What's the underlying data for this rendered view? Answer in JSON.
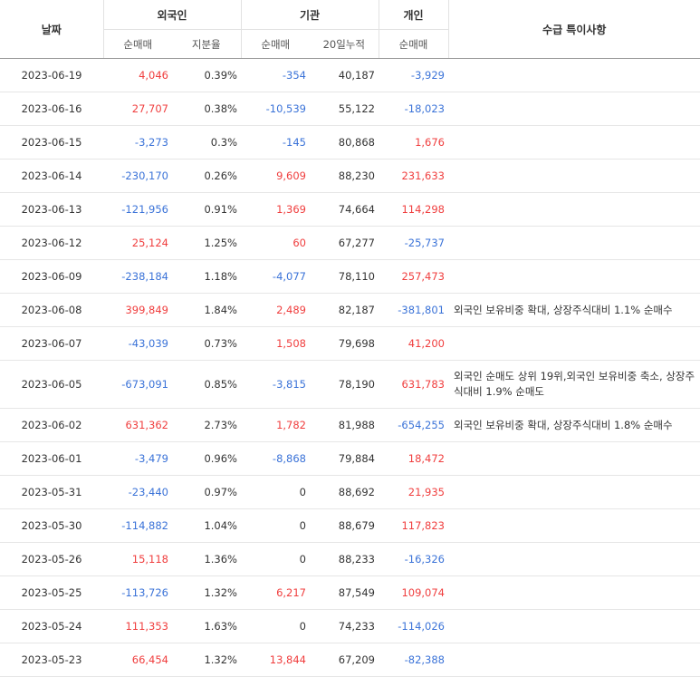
{
  "header": {
    "date": "날짜",
    "foreign": "외국인",
    "institution": "기관",
    "individual": "개인",
    "note": "수급 특이사항",
    "net": "순매매",
    "share": "지분율",
    "acc20": "20일누적"
  },
  "rows": [
    {
      "date": "2023-06-19",
      "f_net": "4,046",
      "f_share": "0.39%",
      "i_net": "-354",
      "i_20": "40,187",
      "p_net": "-3,929",
      "note": ""
    },
    {
      "date": "2023-06-16",
      "f_net": "27,707",
      "f_share": "0.38%",
      "i_net": "-10,539",
      "i_20": "55,122",
      "p_net": "-18,023",
      "note": ""
    },
    {
      "date": "2023-06-15",
      "f_net": "-3,273",
      "f_share": "0.3%",
      "i_net": "-145",
      "i_20": "80,868",
      "p_net": "1,676",
      "note": ""
    },
    {
      "date": "2023-06-14",
      "f_net": "-230,170",
      "f_share": "0.26%",
      "i_net": "9,609",
      "i_20": "88,230",
      "p_net": "231,633",
      "note": ""
    },
    {
      "date": "2023-06-13",
      "f_net": "-121,956",
      "f_share": "0.91%",
      "i_net": "1,369",
      "i_20": "74,664",
      "p_net": "114,298",
      "note": ""
    },
    {
      "date": "2023-06-12",
      "f_net": "25,124",
      "f_share": "1.25%",
      "i_net": "60",
      "i_20": "67,277",
      "p_net": "-25,737",
      "note": ""
    },
    {
      "date": "2023-06-09",
      "f_net": "-238,184",
      "f_share": "1.18%",
      "i_net": "-4,077",
      "i_20": "78,110",
      "p_net": "257,473",
      "note": ""
    },
    {
      "date": "2023-06-08",
      "f_net": "399,849",
      "f_share": "1.84%",
      "i_net": "2,489",
      "i_20": "82,187",
      "p_net": "-381,801",
      "note": "외국인 보유비중 확대, 상장주식대비 1.1% 순매수"
    },
    {
      "date": "2023-06-07",
      "f_net": "-43,039",
      "f_share": "0.73%",
      "i_net": "1,508",
      "i_20": "79,698",
      "p_net": "41,200",
      "note": ""
    },
    {
      "date": "2023-06-05",
      "f_net": "-673,091",
      "f_share": "0.85%",
      "i_net": "-3,815",
      "i_20": "78,190",
      "p_net": "631,783",
      "note": "외국인 순매도 상위 19위,외국인 보유비중 축소, 상장주식대비 1.9% 순매도"
    },
    {
      "date": "2023-06-02",
      "f_net": "631,362",
      "f_share": "2.73%",
      "i_net": "1,782",
      "i_20": "81,988",
      "p_net": "-654,255",
      "note": "외국인 보유비중 확대, 상장주식대비 1.8% 순매수"
    },
    {
      "date": "2023-06-01",
      "f_net": "-3,479",
      "f_share": "0.96%",
      "i_net": "-8,868",
      "i_20": "79,884",
      "p_net": "18,472",
      "note": ""
    },
    {
      "date": "2023-05-31",
      "f_net": "-23,440",
      "f_share": "0.97%",
      "i_net": "0",
      "i_20": "88,692",
      "p_net": "21,935",
      "note": ""
    },
    {
      "date": "2023-05-30",
      "f_net": "-114,882",
      "f_share": "1.04%",
      "i_net": "0",
      "i_20": "88,679",
      "p_net": "117,823",
      "note": ""
    },
    {
      "date": "2023-05-26",
      "f_net": "15,118",
      "f_share": "1.36%",
      "i_net": "0",
      "i_20": "88,233",
      "p_net": "-16,326",
      "note": ""
    },
    {
      "date": "2023-05-25",
      "f_net": "-113,726",
      "f_share": "1.32%",
      "i_net": "6,217",
      "i_20": "87,549",
      "p_net": "109,074",
      "note": ""
    },
    {
      "date": "2023-05-24",
      "f_net": "111,353",
      "f_share": "1.63%",
      "i_net": "0",
      "i_20": "74,233",
      "p_net": "-114,026",
      "note": ""
    },
    {
      "date": "2023-05-23",
      "f_net": "66,454",
      "f_share": "1.32%",
      "i_net": "13,844",
      "i_20": "67,209",
      "p_net": "-82,388",
      "note": ""
    }
  ],
  "colors": {
    "up": "#f03e3e",
    "down": "#3b73d8",
    "neutral": "#333333"
  }
}
